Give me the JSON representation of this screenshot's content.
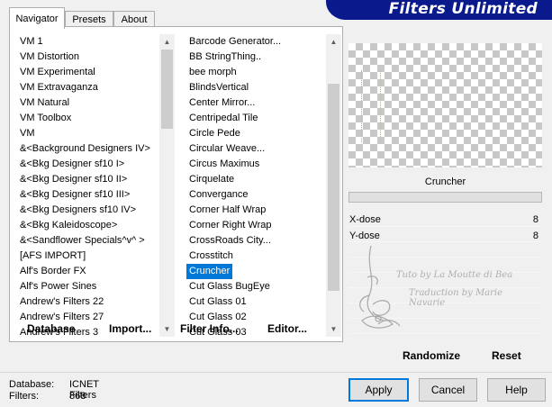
{
  "banner": {
    "title": "Filters Unlimited"
  },
  "tabs": [
    {
      "label": "Navigator"
    },
    {
      "label": "Presets"
    },
    {
      "label": "About"
    }
  ],
  "categories": {
    "items": [
      "VM 1",
      "VM Distortion",
      "VM Experimental",
      "VM Extravaganza",
      "VM Natural",
      "VM Toolbox",
      "VM",
      "&<Background Designers IV>",
      "&<Bkg Designer sf10 I>",
      "&<Bkg Designer sf10 II>",
      "&<Bkg Designer sf10 III>",
      "&<Bkg Designers sf10 IV>",
      "&<Bkg Kaleidoscope>",
      "&<Sandflower Specials^v^ >",
      "[AFS IMPORT]",
      "Alf's Border FX",
      "Alf's Power Sines",
      "Andrew's Filters 22",
      "Andrew's Filters 27",
      "Andrew's Filters 3"
    ]
  },
  "filters": {
    "items": [
      "Barcode Generator...",
      "BB StringThing..",
      "bee morph",
      "BlindsVertical",
      "Center Mirror...",
      "Centripedal Tile",
      "Circle Pede",
      "Circular Weave...",
      "Circus Maximus",
      "Cirquelate",
      "Convergance",
      "Corner Half Wrap",
      "Corner Right Wrap",
      "CrossRoads City...",
      "Crosstitch",
      "Cruncher",
      "Cut Glass  BugEye",
      "Cut Glass 01",
      "Cut Glass 02",
      "Cut Glass 03"
    ],
    "selected": "Cruncher"
  },
  "left_buttons": {
    "database": "Database",
    "import": "Import...",
    "filter_info": "Filter Info...",
    "editor": "Editor..."
  },
  "selected_filter": {
    "name": "Cruncher"
  },
  "params": [
    {
      "label": "X-dose",
      "value": "8"
    },
    {
      "label": "Y-dose",
      "value": "8"
    }
  ],
  "watermark": {
    "line1": "Tuto by La Moutte di Bea",
    "line2": "Traduction by Marie Navarie"
  },
  "right_buttons": {
    "randomize": "Randomize",
    "reset": "Reset"
  },
  "footer": {
    "database_label": "Database:",
    "database_value": "ICNET Filters",
    "filters_label": "Filters:",
    "filters_value": "868"
  },
  "dialog_buttons": {
    "apply": "Apply",
    "cancel": "Cancel",
    "help": "Help"
  },
  "colors": {
    "banner": "#0a1a8c",
    "selection": "#0078d7"
  }
}
